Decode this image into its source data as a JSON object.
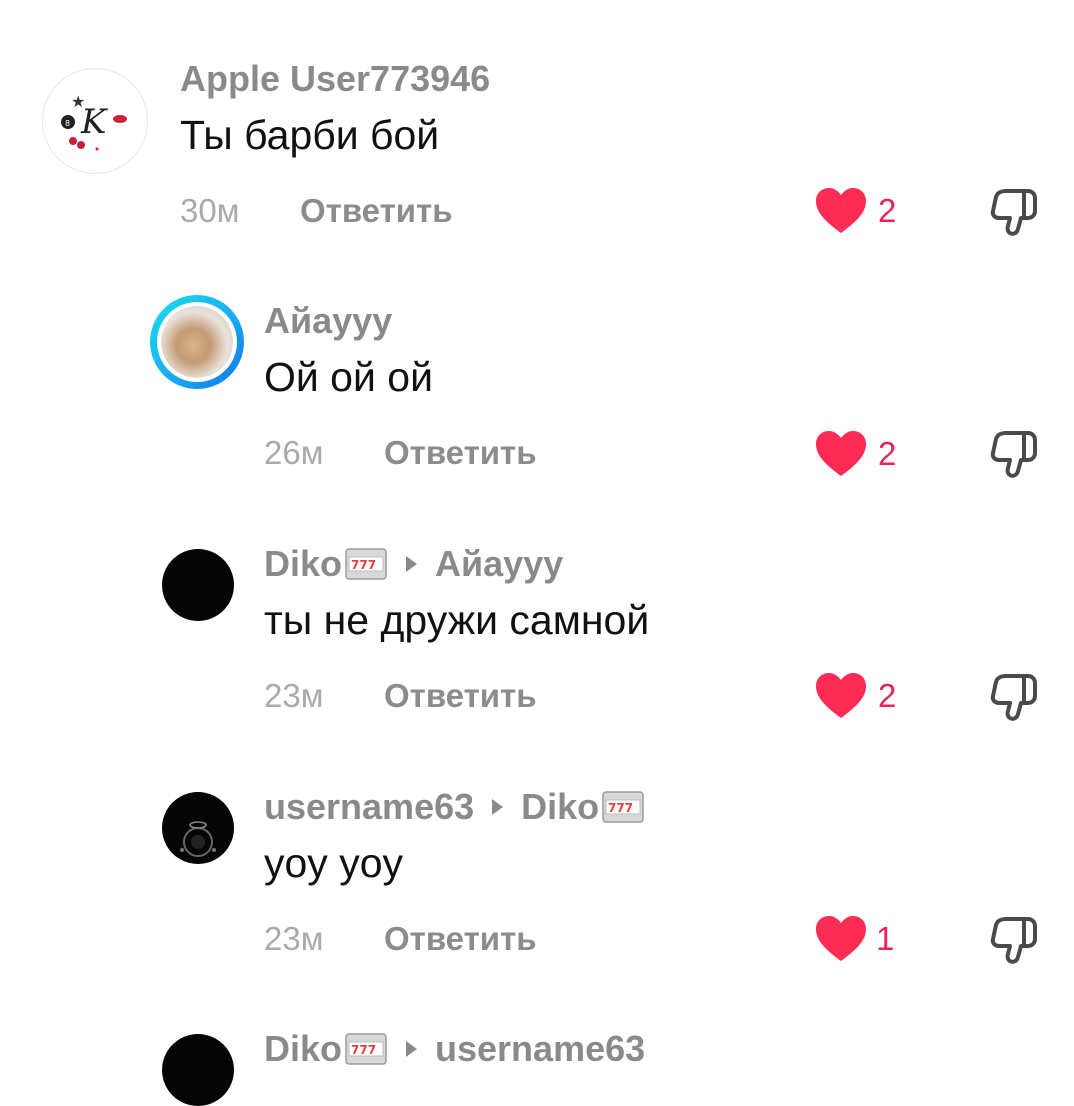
{
  "comments": [
    {
      "user": "Apple User773946",
      "reply_to": "",
      "text": "Ты барби бой",
      "time": "30м",
      "reply_label": "Ответить",
      "likes": "2",
      "avatar": "logo-k"
    },
    {
      "user": "Айауyy",
      "reply_to": "",
      "text": "Ой ой ой",
      "time": "26м",
      "reply_label": "Ответить",
      "likes": "2",
      "avatar": "photo-ring"
    },
    {
      "user": "Diko",
      "reply_to": "Айауyy",
      "text": "ты не дружи самной",
      "time": "23м",
      "reply_label": "Ответить",
      "likes": "2",
      "avatar": "black"
    },
    {
      "user": "username63",
      "reply_to": "Diko",
      "text": "yoy yoy",
      "time": "23м",
      "reply_label": "Ответить",
      "likes": "1",
      "avatar": "black-dots"
    },
    {
      "user": "Diko",
      "reply_to": "username63",
      "text": "",
      "time": "",
      "reply_label": "",
      "likes": "",
      "avatar": "black"
    }
  ],
  "logo_letter": "K",
  "slot_emoji": "777",
  "colors": {
    "heart": "#fe2c55",
    "like_count": "#e8245a",
    "muted": "#8a8a8a"
  }
}
